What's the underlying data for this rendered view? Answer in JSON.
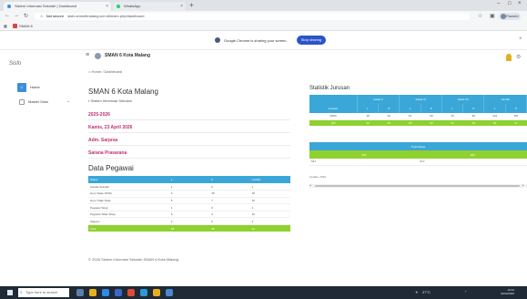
{
  "browser": {
    "tabs": [
      {
        "label": "Sistem Informasi Sekolah | Dashboard"
      },
      {
        "label": "WhatsApp"
      }
    ],
    "new_tab": "+",
    "address": {
      "host": "Not secure",
      "url": "sisfo.smkn6malang.sch.id/index.php/dashboard"
    },
    "bookmarks": [
      {
        "label": "SMAN 6"
      }
    ],
    "profile": "Paused"
  },
  "notice": {
    "text": "Google Chrome is sharing your screen.",
    "button": "Stop sharing"
  },
  "app": {
    "logo": "Sisfo",
    "school_name": "SMAN 6 Kota Malang",
    "breadcrumb": "Home / Dashboard"
  },
  "sidebar": {
    "items": [
      {
        "label": "Home"
      },
      {
        "label": "Master Data"
      }
    ]
  },
  "main": {
    "title": "SMAN 6 Kota Malang",
    "subtitle": "Sistem Informasi Sekolah",
    "year": "2025-2026",
    "date": "Kamis, 23 April 2026",
    "admin": "Adm. Sarpras",
    "sarana": "Sarana Prasarana",
    "pegawai": {
      "title": "Data Pegawai",
      "headers": [
        "Status",
        "L",
        "P",
        "Jumlah"
      ],
      "rows": [
        {
          "label": "Kepala Sekolah",
          "l": "1",
          "p": "0",
          "j": "1"
        },
        {
          "label": "Guru Tetap (PNS)",
          "l": "3",
          "p": "15",
          "j": "18"
        },
        {
          "label": "Guru Tidak Tetap",
          "l": "5",
          "p": "7",
          "j": "12"
        },
        {
          "label": "Pegawai Tetap",
          "l": "1",
          "p": "0",
          "j": "1"
        },
        {
          "label": "Pegawai Tidak Tetap",
          "l": "6",
          "p": "4",
          "j": "10"
        },
        {
          "label": "Satpam",
          "l": "2",
          "p": "0",
          "j": "2"
        }
      ],
      "total": {
        "label": "Total",
        "l": "18",
        "p": "26",
        "j": "44"
      }
    },
    "footer": "© 2026 Sistem Informasi Sekolah SMAN 6 Kota Malang"
  },
  "statistik": {
    "title": "Statistik Jurusan",
    "groups": [
      "Kelas X",
      "Kelas XI",
      "Kelas XII",
      "Jumlah"
    ],
    "subheaders": [
      "Jurusan",
      "L",
      "P",
      "L",
      "P",
      "L",
      "P",
      "L",
      "P"
    ],
    "rows": [
      {
        "cells": [
          "MIPA",
          "48",
          "62",
          "51",
          "59",
          "45",
          "66",
          "144",
          "187"
        ]
      },
      {
        "cells": [
          "IPS",
          "30",
          "35",
          "28",
          "33",
          "31",
          "29",
          "89",
          "97"
        ]
      }
    ],
    "summary_header": "Total Siswa",
    "summary": [
      "233",
      "284"
    ],
    "extra_row": [
      "517",
      "517"
    ],
    "note": "Update: 2026"
  },
  "taskbar": {
    "search_placeholder": "Type here to search",
    "clock": "10:24",
    "date": "23/04/2026",
    "weather": "27°C"
  },
  "colors": {
    "primary": "#3aa7d8",
    "accent": "#8fd12e",
    "magenta": "#c03070"
  }
}
